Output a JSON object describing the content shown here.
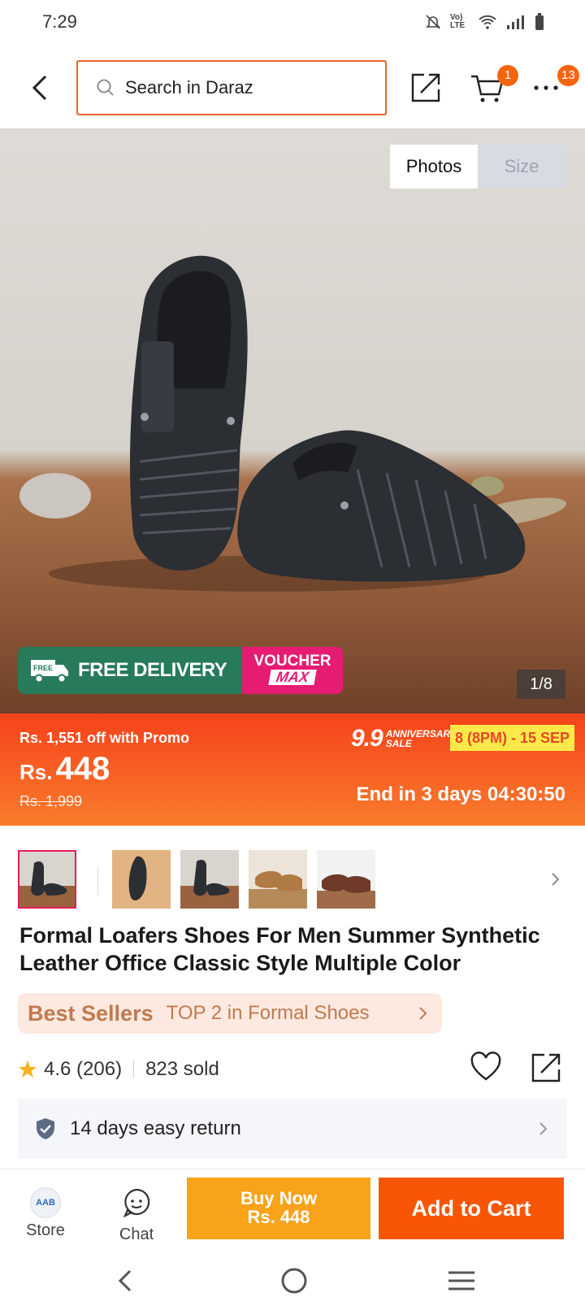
{
  "status_bar": {
    "time": "7:29",
    "network_label": "Vo) LTE"
  },
  "header": {
    "search_placeholder": "Search in Daraz",
    "cart_count": "1",
    "more_count": "13"
  },
  "hero": {
    "tabs": [
      "Photos",
      "Size"
    ],
    "free_delivery": "FREE DELIVERY",
    "free_small": "FREE",
    "voucher_line1": "VOUCHER",
    "voucher_line2": "MAX",
    "counter": "1/8"
  },
  "promo": {
    "promo_off": "Rs. 1,551 off with Promo",
    "currency": "Rs.",
    "price": "448",
    "old_price": "Rs. 1,999",
    "sale_big": "9.9",
    "sale_sub1": "ANNIVERSARY",
    "sale_sub2": "SALE",
    "sale_dates": "8 (8PM) - 15 SEP",
    "end_in": "End in 3 days 04:30:50"
  },
  "product": {
    "title": "Formal Loafers Shoes For Men Summer Synthetic Leather Office Classic Style Multiple Color",
    "best_sellers": "Best Sellers",
    "rank": "TOP 2 in Formal Shoes",
    "rating": "4.6 (206)",
    "sold": "823 sold",
    "returns": "14 days easy return"
  },
  "bottom_bar": {
    "store": "Store",
    "store_logo": "AAB",
    "chat": "Chat",
    "buy_now_1": "Buy Now",
    "buy_now_2": "Rs. 448",
    "add_to_cart": "Add to Cart"
  },
  "colors": {
    "accent": "#f85606",
    "buy_now": "#f9a31b",
    "free_delivery_green": "#277a5a",
    "voucher_pink": "#e51c71"
  }
}
